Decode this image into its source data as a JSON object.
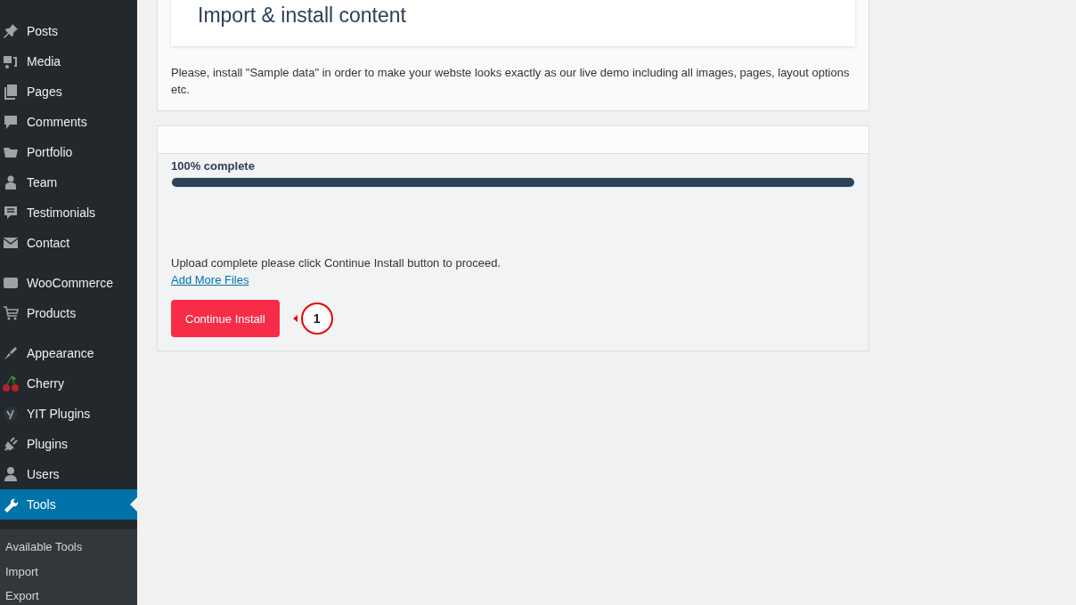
{
  "sidebar": {
    "menu_groups": [
      [
        {
          "label": "Posts",
          "selected": false
        },
        {
          "label": "Media",
          "selected": false
        },
        {
          "label": "Pages",
          "selected": false
        },
        {
          "label": "Comments",
          "selected": false
        },
        {
          "label": "Portfolio",
          "selected": false
        },
        {
          "label": "Team",
          "selected": false
        },
        {
          "label": "Testimonials",
          "selected": false
        },
        {
          "label": "Contact",
          "selected": false
        }
      ],
      [
        {
          "label": "WooCommerce",
          "selected": false
        },
        {
          "label": "Products",
          "selected": false
        }
      ],
      [
        {
          "label": "Appearance",
          "selected": false
        },
        {
          "label": "Cherry",
          "selected": false
        },
        {
          "label": "YIT Plugins",
          "selected": false
        },
        {
          "label": "Plugins",
          "selected": false
        },
        {
          "label": "Users",
          "selected": false
        },
        {
          "label": "Tools",
          "selected": true
        }
      ]
    ],
    "submenu": [
      {
        "label": "Available Tools"
      },
      {
        "label": "Import"
      },
      {
        "label": "Export"
      }
    ]
  },
  "intro_panel": {
    "title": "Import & install content",
    "description": "Please, install \"Sample data\" in order to make your webste looks exactly as our live demo including all images, pages, layout options etc."
  },
  "upload_panel": {
    "progress_label": "100% complete",
    "level": 1,
    "message": "Upload complete please click Continue Install button to proceed.",
    "link": "Add More Files",
    "button": "Continue Install",
    "callout": "1"
  }
}
